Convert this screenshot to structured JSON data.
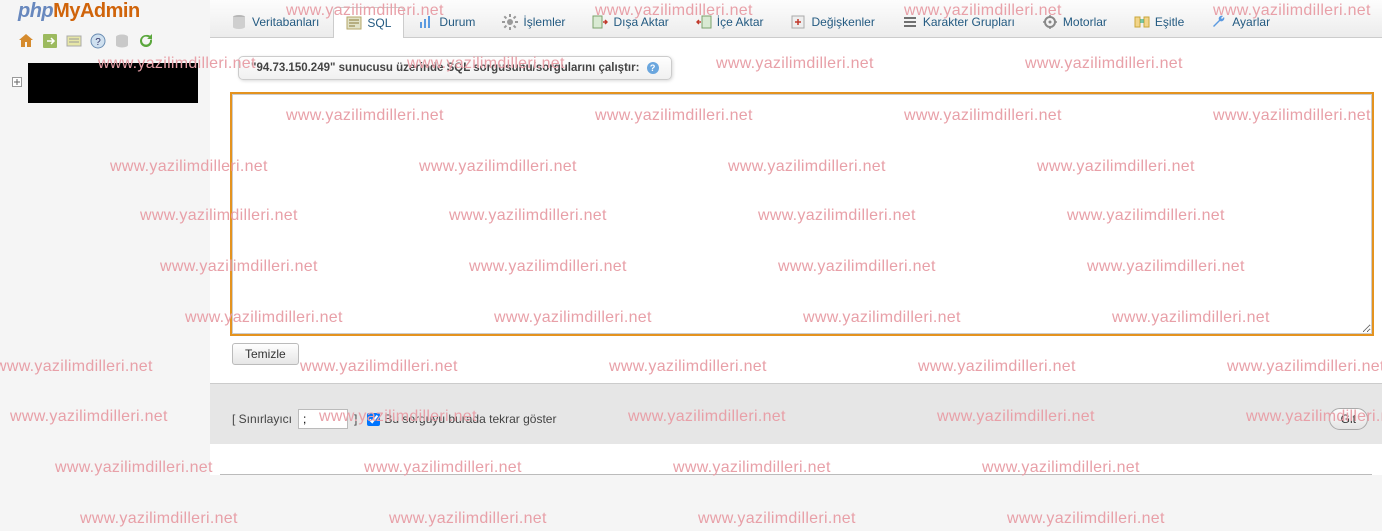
{
  "logo": {
    "php": "php",
    "rest": "MyAdmin"
  },
  "sidebar": {
    "db_placeholder": ""
  },
  "tabs": [
    {
      "label": "Veritabanları"
    },
    {
      "label": "SQL"
    },
    {
      "label": "Durum"
    },
    {
      "label": "İşlemler"
    },
    {
      "label": "Dışa Aktar"
    },
    {
      "label": "İçe Aktar"
    },
    {
      "label": "Değişkenler"
    },
    {
      "label": "Karakter Grupları"
    },
    {
      "label": "Motorlar"
    },
    {
      "label": "Eşitle"
    },
    {
      "label": "Ayarlar"
    }
  ],
  "sql_header": "\"94.73.150.249\" sunucusu üzerinde SQL sorgusunu/sorgularını çalıştır:",
  "sql_value": "",
  "clear_btn": "Temizle",
  "footer": {
    "delimiter_label_open": "[ Sınırlayıcı",
    "delimiter_label_close": "]",
    "delimiter_value": ";",
    "show_again_label": "Bu sorguyu burada tekrar göster",
    "go_btn": "Git"
  },
  "watermark": "www.yazilimdilleri.net",
  "watermark_partial": "ileri.net"
}
